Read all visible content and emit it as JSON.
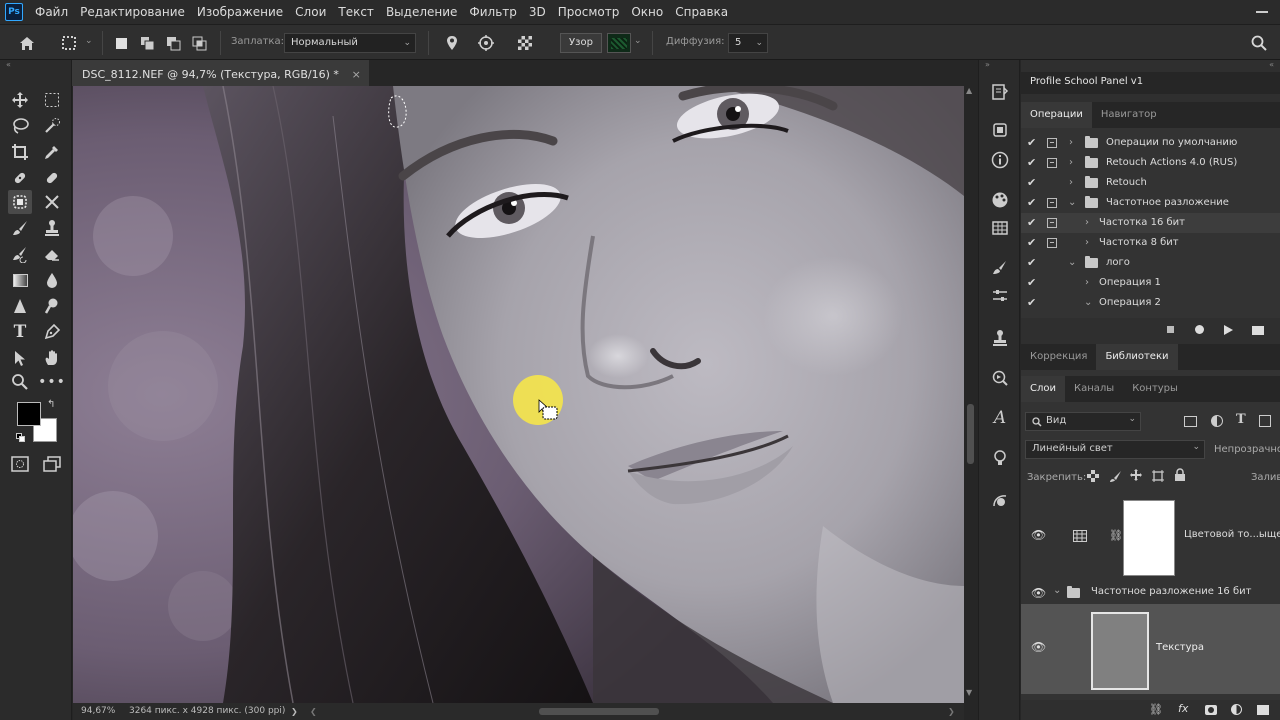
{
  "menubar": {
    "app_logo": "Ps",
    "items": [
      "Файл",
      "Редактирование",
      "Изображение",
      "Слои",
      "Текст",
      "Выделение",
      "Фильтр",
      "3D",
      "Просмотр",
      "Окно",
      "Справка"
    ]
  },
  "options": {
    "patch_label": "Заплатка:",
    "patch_value": "Нормальный",
    "pattern_button": "Узор",
    "diffusion_label": "Диффузия:",
    "diffusion_value": "5"
  },
  "document": {
    "tab_title": "DSC_8112.NEF @ 94,7% (Текстура, RGB/16) *",
    "close_glyph": "×"
  },
  "statusbar": {
    "zoom": "94,67%",
    "info": "3264 пикс. x 4928 пикс. (300 ppi)",
    "arrow": "❯",
    "scroll_left": "❮",
    "scroll_right": "❯"
  },
  "panel_header": "Profile School Panel v1",
  "actions_panel": {
    "tabs": [
      "Операции",
      "Навигатор"
    ],
    "rows": [
      {
        "label": "Операции по умолчанию"
      },
      {
        "label": "Retouch Actions 4.0 (RUS)"
      },
      {
        "label": "Retouch"
      },
      {
        "label": "Частотное разложение"
      },
      {
        "label": "Частотка 16 бит"
      },
      {
        "label": "Частотка 8 бит"
      },
      {
        "label": "лого"
      },
      {
        "label": "Операция 1"
      },
      {
        "label": "Операция 2"
      }
    ]
  },
  "adjust_panel": {
    "tabs": [
      "Коррекция",
      "Библиотеки"
    ]
  },
  "layers_panel": {
    "tabs": [
      "Слои",
      "Каналы",
      "Контуры"
    ],
    "filter_kind": "Вид",
    "blend_mode": "Линейный свет",
    "opacity_label": "Непрозрачнос",
    "lock_label": "Закрепить:",
    "fill_label": "Залив",
    "layers": [
      {
        "name": "Цветовой то...ыщенн"
      },
      {
        "name": "Частотное разложение 16 бит"
      },
      {
        "name": "Текстура"
      }
    ],
    "fx_label": "fx"
  },
  "colors": {
    "foreground": "#000000",
    "background": "#ffffff",
    "accent_cursor": "#f5e64a"
  }
}
